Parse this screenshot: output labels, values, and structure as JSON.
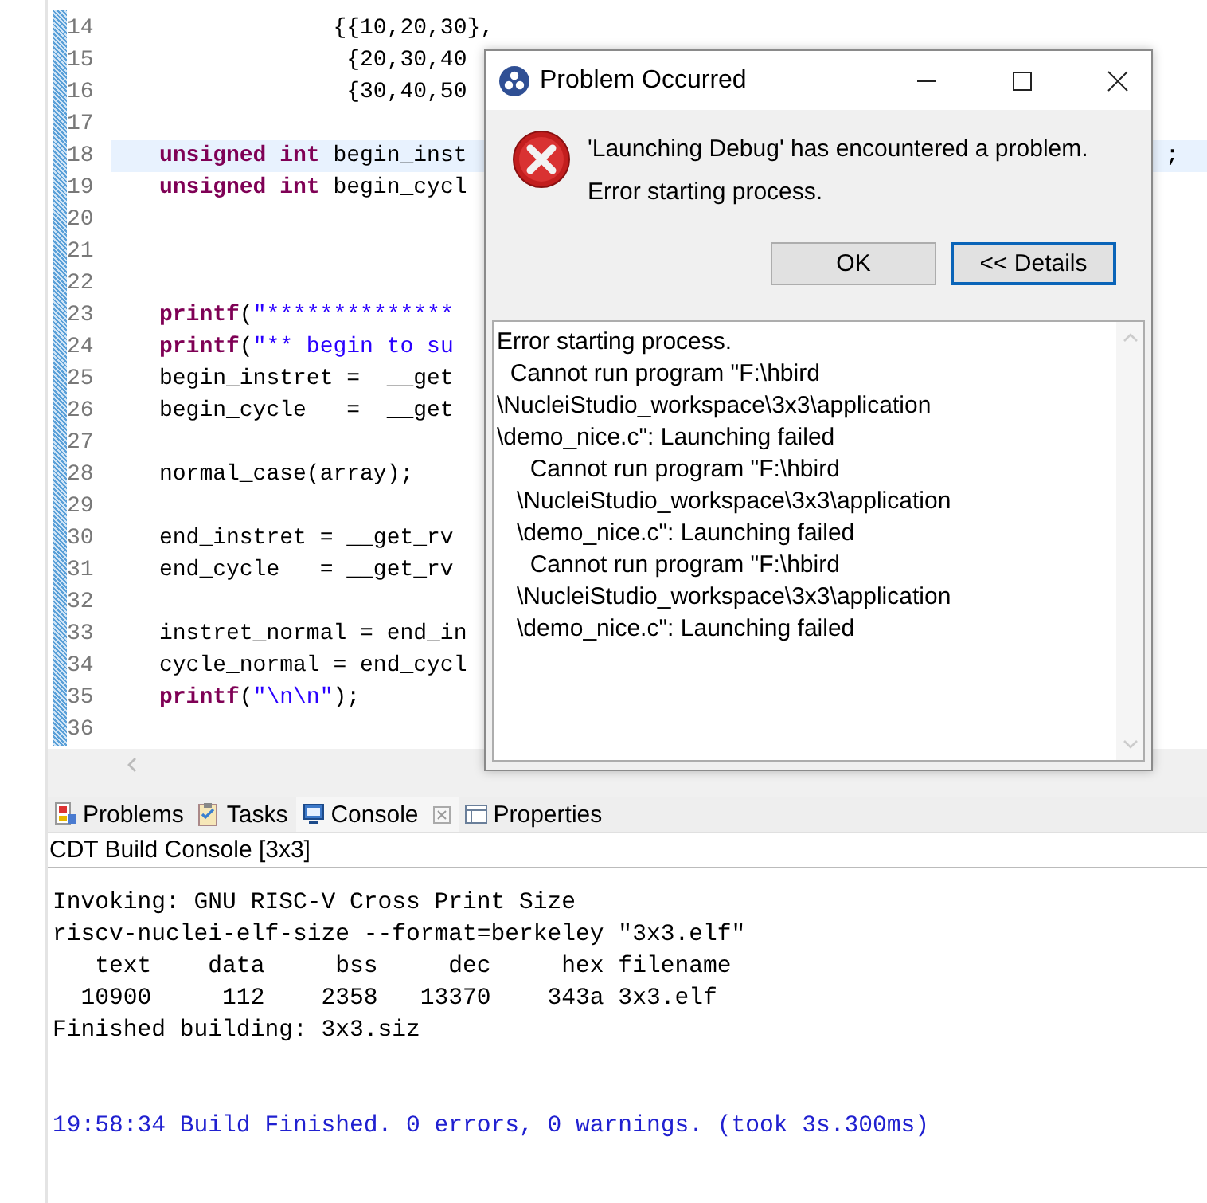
{
  "editor": {
    "lines": [
      {
        "number": "14",
        "current": false,
        "segments": [
          {
            "kind": "plain",
            "text": "             {{10,20,30},"
          }
        ]
      },
      {
        "number": "15",
        "current": false,
        "segments": [
          {
            "kind": "plain",
            "text": "              {20,30,40"
          }
        ]
      },
      {
        "number": "16",
        "current": false,
        "segments": [
          {
            "kind": "plain",
            "text": "              {30,40,50"
          }
        ]
      },
      {
        "number": "17",
        "current": false
      },
      {
        "number": "18",
        "current": true,
        "segments": [
          {
            "kind": "keyword",
            "text": "unsigned int"
          },
          {
            "kind": "plain",
            "text": " begin_inst"
          }
        ],
        "tail": ";"
      },
      {
        "number": "19",
        "current": false,
        "segments": [
          {
            "kind": "keyword",
            "text": "unsigned int"
          },
          {
            "kind": "plain",
            "text": " begin_cycl"
          }
        ]
      },
      {
        "number": "20",
        "current": false
      },
      {
        "number": "21",
        "current": false
      },
      {
        "number": "22",
        "current": false
      },
      {
        "number": "23",
        "current": false,
        "segments": [
          {
            "kind": "keyword",
            "text": "printf"
          },
          {
            "kind": "plain",
            "text": "("
          },
          {
            "kind": "string",
            "text": "\"**************"
          }
        ]
      },
      {
        "number": "24",
        "current": false,
        "segments": [
          {
            "kind": "keyword",
            "text": "printf"
          },
          {
            "kind": "plain",
            "text": "("
          },
          {
            "kind": "string",
            "text": "\"** begin to su"
          }
        ]
      },
      {
        "number": "25",
        "current": false,
        "segments": [
          {
            "kind": "plain",
            "text": "begin_instret =  __get"
          }
        ]
      },
      {
        "number": "26",
        "current": false,
        "segments": [
          {
            "kind": "plain",
            "text": "begin_cycle   =  __get"
          }
        ]
      },
      {
        "number": "27",
        "current": false
      },
      {
        "number": "28",
        "current": false,
        "segments": [
          {
            "kind": "plain",
            "text": "normal_case(array);"
          }
        ]
      },
      {
        "number": "29",
        "current": false
      },
      {
        "number": "30",
        "current": false,
        "segments": [
          {
            "kind": "plain",
            "text": "end_instret = __get_rv"
          }
        ]
      },
      {
        "number": "31",
        "current": false,
        "segments": [
          {
            "kind": "plain",
            "text": "end_cycle   = __get_rv"
          }
        ]
      },
      {
        "number": "32",
        "current": false
      },
      {
        "number": "33",
        "current": false,
        "segments": [
          {
            "kind": "plain",
            "text": "instret_normal = end_in"
          }
        ]
      },
      {
        "number": "34",
        "current": false,
        "segments": [
          {
            "kind": "plain",
            "text": "cycle_normal = end_cycl"
          }
        ]
      },
      {
        "number": "35",
        "current": false,
        "segments": [
          {
            "kind": "keyword",
            "text": "printf"
          },
          {
            "kind": "plain",
            "text": "("
          },
          {
            "kind": "string",
            "text": "\"\\n\\n\""
          },
          {
            "kind": "plain",
            "text": ");"
          }
        ]
      },
      {
        "number": "36",
        "current": false
      }
    ]
  },
  "tabs": [
    {
      "label": "Problems",
      "kind": "problems",
      "selected": false
    },
    {
      "label": "Tasks",
      "kind": "tasks",
      "selected": false
    },
    {
      "label": "Console",
      "kind": "console",
      "selected": true
    },
    {
      "label": "Properties",
      "kind": "properties",
      "selected": false
    }
  ],
  "console": {
    "title": "CDT Build Console [3x3]",
    "lines": [
      {
        "kind": "normal",
        "text": "Invoking: GNU RISC-V Cross Print Size"
      },
      {
        "kind": "normal",
        "text": "riscv-nuclei-elf-size --format=berkeley \"3x3.elf\""
      },
      {
        "kind": "normal",
        "text": "   text    data     bss     dec     hex filename"
      },
      {
        "kind": "normal",
        "text": "  10900     112    2358   13370    343a 3x3.elf"
      },
      {
        "kind": "normal",
        "text": "Finished building: 3x3.siz"
      },
      {
        "kind": "blank"
      },
      {
        "kind": "blank"
      },
      {
        "kind": "info",
        "text": "19:58:34 Build Finished. 0 errors, 0 warnings. (took 3s.300ms)"
      }
    ]
  },
  "dialog": {
    "title": "Problem Occurred",
    "message": "'Launching Debug' has encountered a problem.",
    "reason": "Error starting process.",
    "buttons": [
      {
        "label": "OK",
        "focused": false
      },
      {
        "label": "<< Details",
        "focused": true
      }
    ],
    "details": [
      "Error starting process.",
      "  Cannot run program \"F:\\hbird",
      "\\NucleiStudio_workspace\\3x3\\application",
      "\\demo_nice.c\": Launching failed",
      "     Cannot run program \"F:\\hbird",
      "   \\NucleiStudio_workspace\\3x3\\application",
      "   \\demo_nice.c\": Launching failed",
      "     Cannot run program \"F:\\hbird",
      "   \\NucleiStudio_workspace\\3x3\\application",
      "   \\demo_nice.c\": Launching failed"
    ]
  }
}
